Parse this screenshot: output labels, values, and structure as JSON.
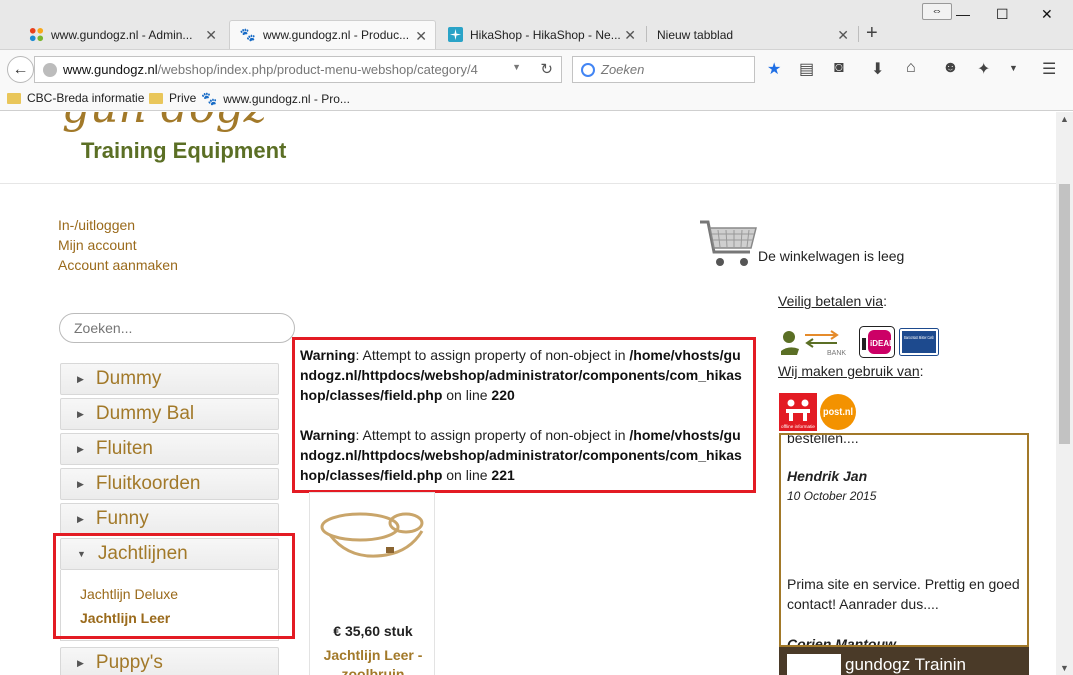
{
  "browser": {
    "tabs": [
      {
        "title": "www.gundogz.nl - Admin...",
        "icon": "joomla-icon",
        "active": false
      },
      {
        "title": "www.gundogz.nl - Produc...",
        "icon": "paw-icon",
        "active": true
      },
      {
        "title": "HikaShop - HikaShop - Ne...",
        "icon": "hikashop-icon",
        "active": false
      },
      {
        "title": "Nieuw tabblad",
        "icon": "",
        "active": false
      }
    ],
    "url_host": "www.gundogz.nl",
    "url_path": "/webshop/index.php/product-menu-webshop/category/4",
    "search_placeholder": "Zoeken",
    "bookmarks": [
      {
        "label": "CBC-Breda informatie",
        "icon": "folder-icon"
      },
      {
        "label": "Prive",
        "icon": "folder-icon"
      },
      {
        "label": "www.gundogz.nl - Pro...",
        "icon": "paw-icon"
      }
    ]
  },
  "page": {
    "logo_top": "gun dogz",
    "logo_sub": "Training Equipment",
    "user_links": [
      "In-/uitloggen",
      "Mijn account",
      "Account aanmaken"
    ],
    "cart_text": "De winkelwagen is leeg",
    "search_placeholder": "Zoeken...",
    "categories": [
      {
        "label": "Dummy",
        "open": false
      },
      {
        "label": "Dummy Bal",
        "open": false
      },
      {
        "label": "Fluiten",
        "open": false
      },
      {
        "label": "Fluitkoorden",
        "open": false
      },
      {
        "label": "Funny",
        "open": false
      },
      {
        "label": "Jachtlijnen",
        "open": true
      },
      {
        "label": "Puppy's",
        "open": false
      }
    ],
    "subcategories": [
      {
        "label": "Jachtlijn Deluxe",
        "current": false
      },
      {
        "label": "Jachtlijn Leer",
        "current": true
      }
    ],
    "warnings": [
      {
        "label": "Warning",
        "message": ": Attempt to assign property of non-object in ",
        "path": "/home/vhosts/gundogz.nl/httpdocs/webshop/administrator/components/com_hikashop/classes/field.php",
        "on_line": " on line ",
        "line": "220"
      },
      {
        "label": "Warning",
        "message": ": Attempt to assign property of non-object in ",
        "path": "/home/vhosts/gundogz.nl/httpdocs/webshop/administrator/components/com_hikashop/classes/field.php",
        "on_line": " on line ",
        "line": "221"
      }
    ],
    "product": {
      "price": "€ 35,60 stuk",
      "name": "Jachtlijn Leer - zoolbruin"
    },
    "payment_title": "Veilig betalen via",
    "payment_colon": ":",
    "payment_logos": [
      "BANK",
      "iDEAL",
      "Bancontact Mister Cash"
    ],
    "usage_title": "Wij maken gebruik van",
    "usage_colon": ":",
    "usage_logos": [
      "offline informatie",
      "post.nl"
    ],
    "reviews": {
      "top_text": "bestellen....",
      "name": "Hendrik Jan",
      "date": "10 October 2015",
      "text": "Prima site en service. Prettig en goed contact! Aanrader dus....",
      "next_name": "Corien Mantouw"
    },
    "facebook_title": "gundogz Trainin"
  },
  "colors": {
    "accent_brown": "#a27929",
    "logo_green": "#5b6f25",
    "warning_border": "#e31b23"
  }
}
